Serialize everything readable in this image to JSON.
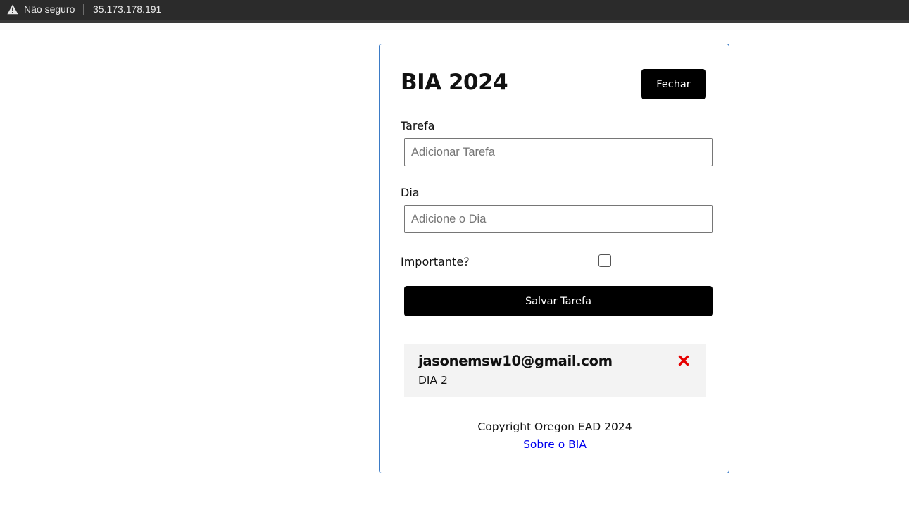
{
  "browser": {
    "security_label": "Não seguro",
    "security_icon": "warning-icon",
    "url": "35.173.178.191"
  },
  "app": {
    "title": "BIA 2024",
    "close_button": "Fechar",
    "form": {
      "task_label": "Tarefa",
      "task_placeholder": "Adicionar Tarefa",
      "task_value": "",
      "day_label": "Dia",
      "day_placeholder": "Adicione o Dia",
      "day_value": "",
      "important_label": "Importante?",
      "important_checked": false,
      "save_button": "Salvar Tarefa"
    },
    "tasks": [
      {
        "title": "jasonemsw10@gmail.com",
        "day": "DIA 2",
        "delete_icon": "close-x-icon",
        "delete_color": "#e60000"
      }
    ],
    "footer": {
      "copyright": "Copyright Oregon EAD 2024",
      "about_link": "Sobre o BIA"
    }
  },
  "colors": {
    "card_border": "#3b7bc6",
    "button_bg": "#000000",
    "task_bg": "#f3f3f3",
    "link": "#0000ee"
  }
}
